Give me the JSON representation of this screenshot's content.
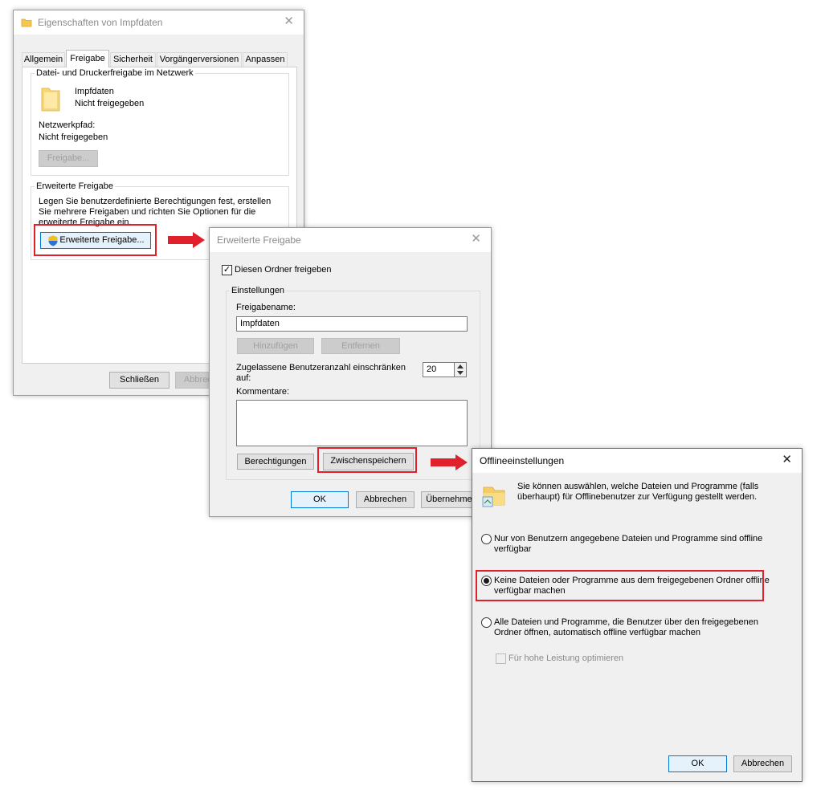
{
  "props": {
    "title": "Eigenschaften von Impfdaten",
    "tabs": [
      "Allgemein",
      "Freigabe",
      "Sicherheit",
      "Vorgängerversionen",
      "Anpassen"
    ],
    "section1_label": "Datei- und Druckerfreigabe im Netzwerk",
    "folder_name": "Impfdaten",
    "folder_status": "Nicht freigegeben",
    "netpath_label": "Netzwerkpfad:",
    "netpath_value": "Nicht freigegeben",
    "share_button": "Freigabe...",
    "section2_label": "Erweiterte Freigabe",
    "section2_desc": "Legen Sie benutzerdefinierte Berechtigungen fest, erstellen Sie mehrere Freigaben und richten Sie Optionen für die erweiterte Freigabe ein.",
    "adv_button": "Erweiterte Freigabe...",
    "close_button": "Schließen",
    "cancel_button": "Abbrechen"
  },
  "adv": {
    "title": "Erweiterte Freigabe",
    "share_checkbox": "Diesen Ordner freigeben",
    "share_checked": true,
    "settings_label": "Einstellungen",
    "sharename_label": "Freigabename:",
    "sharename_value": "Impfdaten",
    "add_button": "Hinzufügen",
    "remove_button": "Entfernen",
    "userlimit_label": "Zugelassene Benutzeranzahl einschränken auf:",
    "userlimit_value": "20",
    "comments_label": "Kommentare:",
    "comments_value": "",
    "permissions_button": "Berechtigungen",
    "caching_button": "Zwischenspeichern",
    "ok_button": "OK",
    "cancel_button": "Abbrechen",
    "apply_button": "Übernehmen"
  },
  "offline": {
    "title": "Offlineeinstellungen",
    "intro": "Sie können auswählen, welche Dateien und Programme (falls überhaupt) für Offlinebenutzer zur Verfügung gestellt werden.",
    "option1": "Nur von Benutzern angegebene Dateien und Programme sind offline verfügbar",
    "option2": "Keine Dateien oder Programme aus dem freigegebenen Ordner offline verfügbar machen",
    "option3": "Alle Dateien und Programme, die Benutzer über den freigegebenen Ordner öffnen, automatisch offline verfügbar machen",
    "selected_option": 2,
    "perf_checkbox": "Für hohe Leistung optimieren",
    "ok_button": "OK",
    "cancel_button": "Abbrechen"
  },
  "colors": {
    "highlight": "#e0202b",
    "accent": "#0078d7"
  }
}
